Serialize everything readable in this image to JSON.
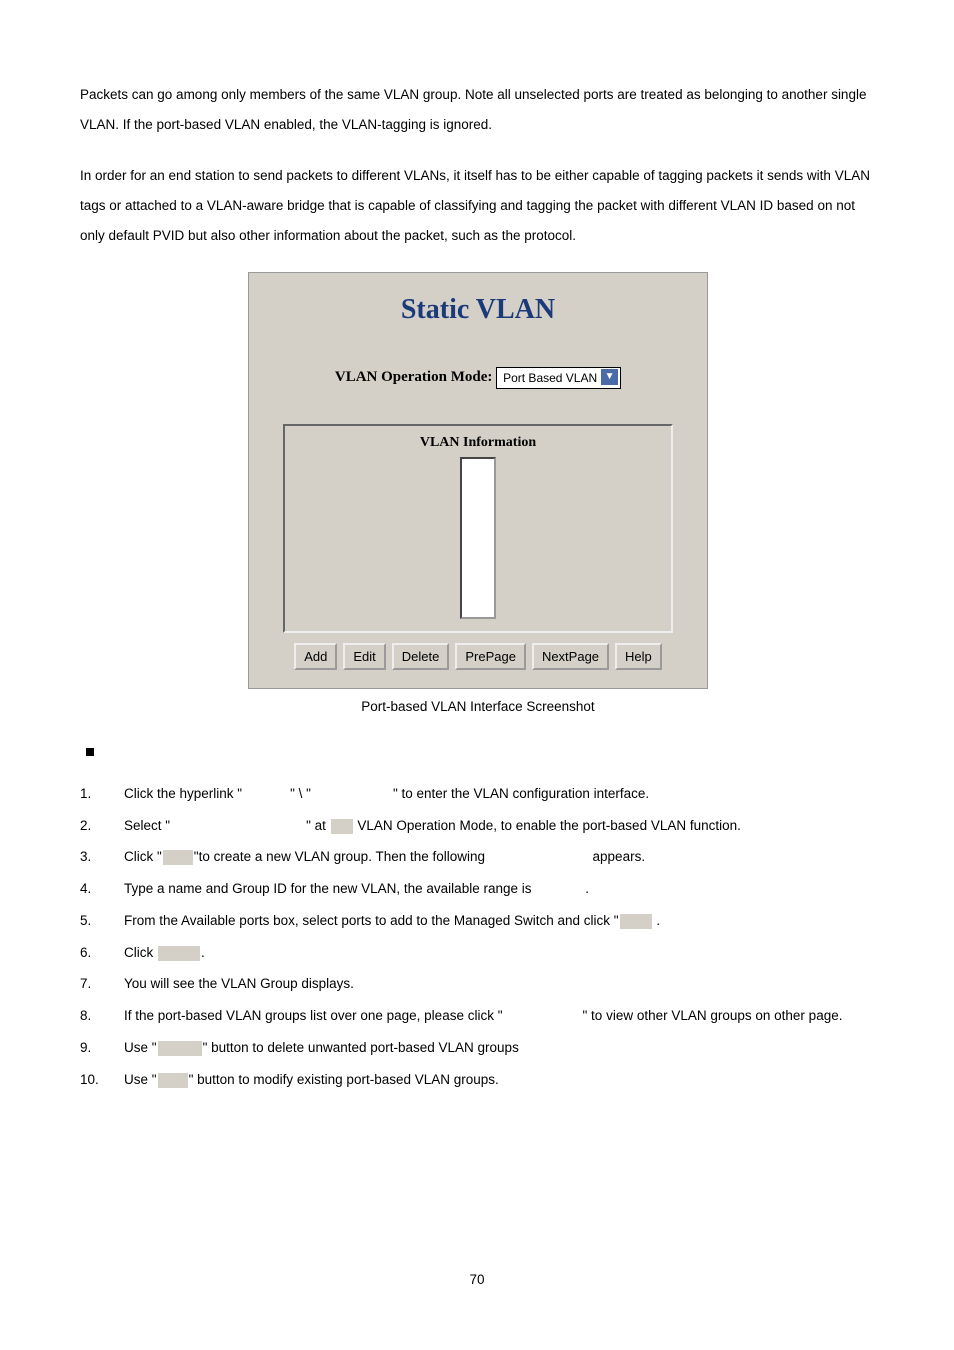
{
  "para1": "Packets can go among only members of the same VLAN group. Note all unselected ports are treated as belonging to another single VLAN. If the port-based VLAN enabled, the VLAN-tagging is ignored.",
  "para2": "In order for an end station to send packets to different VLANs, it itself has to be either capable of tagging packets it sends with VLAN tags or attached to a VLAN-aware bridge that is capable of classifying and tagging the packet with different VLAN ID based on not only default PVID but also other information about the packet, such as the protocol.",
  "screenshot": {
    "title": "Static VLAN",
    "mode_label": "VLAN Operation Mode:",
    "mode_value": "Port Based VLAN",
    "info_title": "VLAN Information",
    "buttons": [
      "Add",
      "Edit",
      "Delete",
      "PrePage",
      "NextPage",
      "Help"
    ]
  },
  "caption": "Port-based VLAN Interface Screenshot",
  "steps": [
    {
      "n": "1.",
      "parts": [
        {
          "t": "Click the hyperlink \""
        },
        {
          "gap": 48
        },
        {
          "t": "\" \\ \""
        },
        {
          "gap": 82
        },
        {
          "t": "\" to enter the VLAN configuration interface."
        }
      ]
    },
    {
      "n": "2.",
      "parts": [
        {
          "t": "Select \""
        },
        {
          "gap": 136
        },
        {
          "t": "\" at "
        },
        {
          "shade": "w-the"
        },
        {
          "t": " VLAN Operation Mode, to enable the port-based VLAN function."
        }
      ]
    },
    {
      "n": "3.",
      "parts": [
        {
          "t": "Click \""
        },
        {
          "shade": "w-add"
        },
        {
          "t": "\"to create a new VLAN group. Then the following "
        },
        {
          "gap": 100
        },
        {
          "t": " appears."
        }
      ]
    },
    {
      "n": "4.",
      "parts": [
        {
          "t": "Type a name and Group ID for the new VLAN, the available range is "
        },
        {
          "gap": 50
        },
        {
          "t": "."
        }
      ]
    },
    {
      "n": "5.",
      "parts": [
        {
          "t": "From the Available ports box, select ports to add to the Managed Switch and click \""
        },
        {
          "shade": "w-add2"
        },
        {
          "t": " ."
        }
      ]
    },
    {
      "n": "6.",
      "parts": [
        {
          "t": "Click "
        },
        {
          "shade": "w-apply"
        },
        {
          "t": "."
        }
      ]
    },
    {
      "n": "7.",
      "parts": [
        {
          "t": "You will see the VLAN Group displays."
        }
      ]
    },
    {
      "n": "8.",
      "parts": [
        {
          "t": "If the port-based VLAN groups list over one page, please click \""
        },
        {
          "gap": 80
        },
        {
          "t": "\" to view other VLAN groups on other page."
        }
      ]
    },
    {
      "n": "9.",
      "parts": [
        {
          "t": "Use \""
        },
        {
          "shade": "w-delete"
        },
        {
          "t": "\" button to delete unwanted port-based VLAN groups"
        }
      ]
    },
    {
      "n": "10.",
      "parts": [
        {
          "t": "Use \""
        },
        {
          "shade": "w-edit"
        },
        {
          "t": "\" button to modify existing port-based VLAN groups."
        }
      ]
    }
  ],
  "page_number": "70"
}
